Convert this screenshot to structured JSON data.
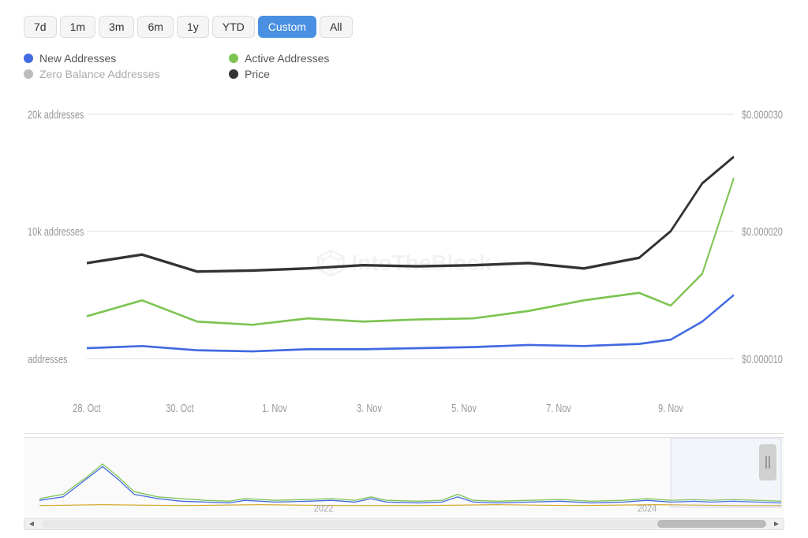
{
  "timeRange": {
    "buttons": [
      "7d",
      "1m",
      "3m",
      "6m",
      "1y",
      "YTD",
      "Custom",
      "All"
    ],
    "active": "Custom"
  },
  "legend": {
    "items": [
      {
        "label": "New Addresses",
        "color": "#4169e1",
        "dimmed": false
      },
      {
        "label": "Active Addresses",
        "color": "#7dc452",
        "dimmed": false
      },
      {
        "label": "Zero Balance Addresses",
        "color": "#bbb",
        "dimmed": true
      },
      {
        "label": "Price",
        "color": "#333",
        "dimmed": false
      }
    ]
  },
  "yAxisLeft": {
    "labels": [
      "20k addresses",
      "10k addresses",
      "addresses"
    ]
  },
  "yAxisRight": {
    "labels": [
      "$0.000030",
      "$0.000020",
      "$0.000010"
    ]
  },
  "xAxis": {
    "labels": [
      "28. Oct",
      "30. Oct",
      "1. Nov",
      "3. Nov",
      "5. Nov",
      "7. Nov",
      "9. Nov"
    ]
  },
  "watermark": "IntoTheBlock",
  "miniChart": {
    "year2022": "2022",
    "year2024": "2024"
  },
  "scrollbar": {
    "leftArrow": "◄",
    "rightArrow": "►"
  }
}
